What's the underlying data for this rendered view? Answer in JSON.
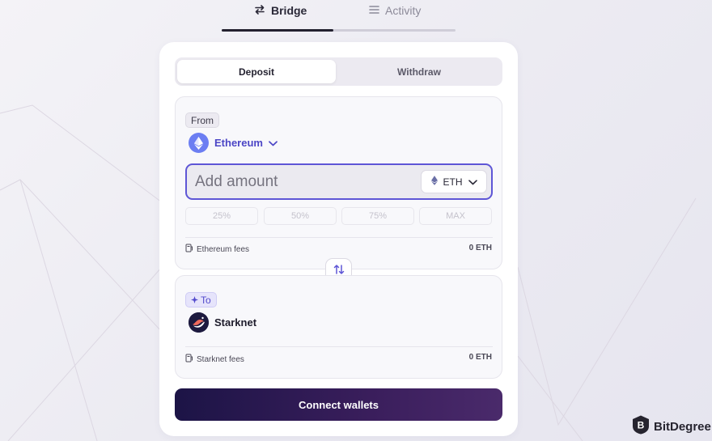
{
  "nav": {
    "bridge_label": "Bridge",
    "activity_label": "Activity",
    "active_tab": "Bridge"
  },
  "mode": {
    "deposit_label": "Deposit",
    "withdraw_label": "Withdraw",
    "active": "Deposit"
  },
  "from": {
    "chip_label": "From",
    "network_name": "Ethereum",
    "amount_placeholder": "Add amount",
    "amount_value": "",
    "token_symbol": "ETH",
    "percent_options": [
      "25%",
      "50%",
      "75%",
      "MAX"
    ],
    "fees_label": "Ethereum fees",
    "fees_value": "0 ETH"
  },
  "to": {
    "chip_label": "To",
    "network_name": "Starknet",
    "fees_label": "Starknet fees",
    "fees_value": "0 ETH"
  },
  "connect_label": "Connect wallets",
  "watermark": {
    "brand": "BitDegree"
  },
  "colors": {
    "accent": "#5e56d6",
    "network_link": "#4c46c6",
    "button_start": "#1c1446",
    "button_end": "#4a2a6b"
  },
  "icons": {
    "bridge": "swap-arrows-icon",
    "activity": "list-icon",
    "ethereum": "ethereum-diamond-icon",
    "chevron": "chevron-down-icon",
    "fees": "receipt-icon",
    "swap": "swap-vertical-icon",
    "to_sparkle": "sparkle-icon",
    "starknet": "starknet-logo-icon"
  }
}
